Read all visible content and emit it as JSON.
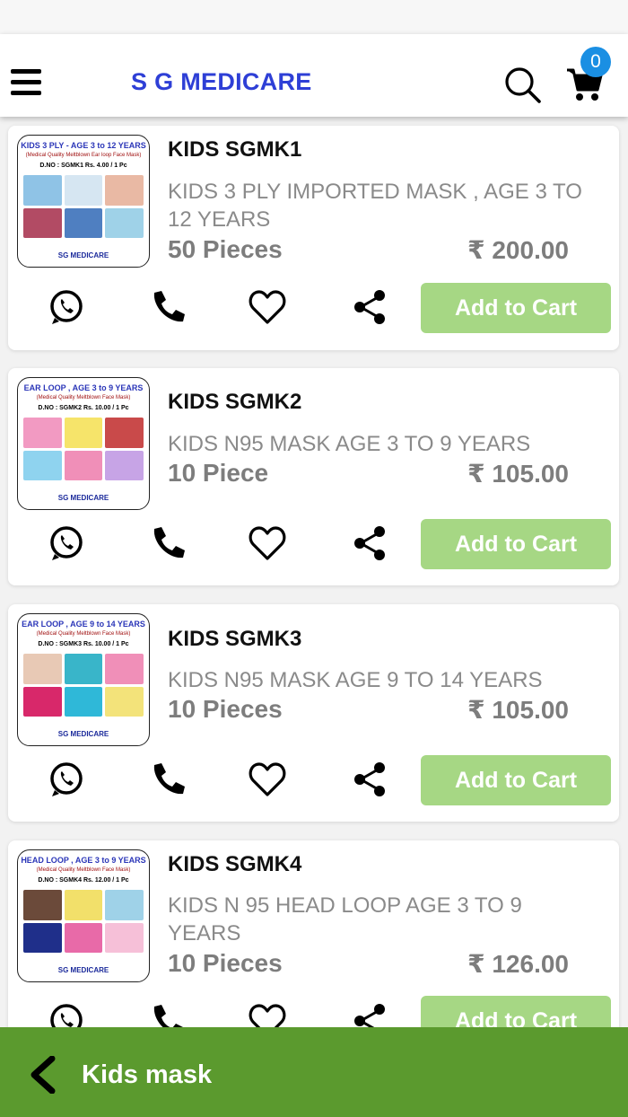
{
  "header": {
    "brand": "S G MEDICARE",
    "cart_count": "0"
  },
  "products": [
    {
      "title": "KIDS SGMK1",
      "description": "KIDS 3 PLY IMPORTED MASK , AGE 3 TO 12 YEARS",
      "quantity": "50 Pieces",
      "price": "₹ 200.00",
      "add_label": "Add to Cart",
      "thumb": {
        "caption": "KIDS 3 PLY - AGE 3 to 12 YEARS",
        "subcaption": "(Medical Quality Meltblown Ear loop Face Mask)",
        "code": "D.NO : SGMK1   Rs. 4.00 / 1 Pc",
        "logo": "SG MEDICARE"
      }
    },
    {
      "title": "KIDS SGMK2",
      "description": "KIDS N95 MASK AGE 3 TO 9 YEARS",
      "quantity": "10 Piece",
      "price": "₹ 105.00",
      "add_label": "Add to Cart",
      "thumb": {
        "caption": "EAR LOOP , AGE 3 to 9 YEARS",
        "subcaption": "(Medical Quality Meltblown Face Mask)",
        "code": "D.NO : SGMK2   Rs. 10.00 / 1 Pc",
        "logo": "SG MEDICARE"
      }
    },
    {
      "title": "KIDS SGMK3",
      "description": "KIDS N95 MASK AGE 9 TO 14 YEARS",
      "quantity": "10 Pieces",
      "price": "₹ 105.00",
      "add_label": "Add to Cart",
      "thumb": {
        "caption": "EAR LOOP , AGE 9 to 14 YEARS",
        "subcaption": "(Medical Quality Meltblown Face Mask)",
        "code": "D.NO : SGMK3   Rs. 10.00 / 1 Pc",
        "logo": "SG MEDICARE"
      }
    },
    {
      "title": "KIDS SGMK4",
      "description": "KIDS N 95 HEAD LOOP AGE 3 TO 9 YEARS",
      "quantity": "10 Pieces",
      "price": "₹ 126.00",
      "add_label": "Add to Cart",
      "thumb": {
        "caption": "HEAD LOOP , AGE 3 to 9 YEARS",
        "subcaption": "(Medical Quality Meltblown Face Mask)",
        "code": "D.NO : SGMK4   Rs. 12.00 / 1 Pc",
        "logo": "SG MEDICARE"
      }
    }
  ],
  "bottom_bar": {
    "title": "Kids mask"
  },
  "colors": {
    "accent_green": "#a6d784",
    "bar_green": "#5b9a2e",
    "brand_blue": "#2e3fd6",
    "badge_blue": "#1a8fe3"
  },
  "icons": [
    "menu-icon",
    "search-icon",
    "cart-icon",
    "whatsapp-icon",
    "phone-icon",
    "heart-icon",
    "share-icon",
    "back-icon"
  ]
}
